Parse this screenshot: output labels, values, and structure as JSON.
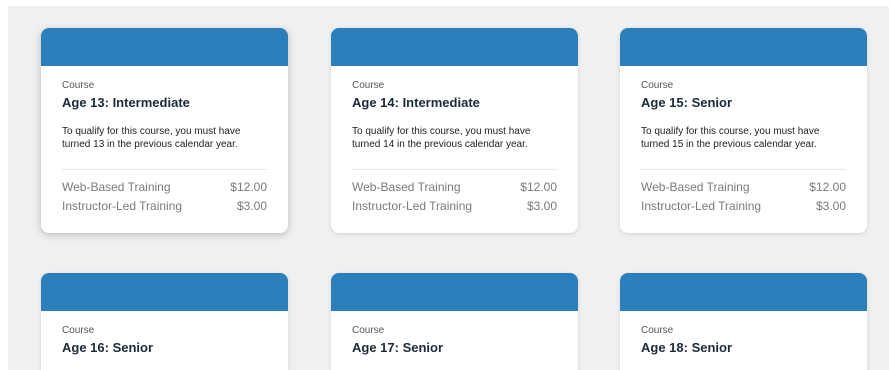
{
  "courses": [
    {
      "kind": "Course",
      "title": "Age 13: Intermediate",
      "description": "To qualify for this course, you must have turned 13 in the previous calendar year.",
      "prices": [
        {
          "label": "Web-Based Training",
          "price": "$12.00"
        },
        {
          "label": "Instructor-Led Training",
          "price": "$3.00"
        }
      ]
    },
    {
      "kind": "Course",
      "title": "Age 14: Intermediate",
      "description": "To qualify for this course, you must have turned 14 in the previous calendar year.",
      "prices": [
        {
          "label": "Web-Based Training",
          "price": "$12.00"
        },
        {
          "label": "Instructor-Led Training",
          "price": "$3.00"
        }
      ]
    },
    {
      "kind": "Course",
      "title": "Age 15: Senior",
      "description": "To qualify for this course, you must have turned 15 in the previous calendar year.",
      "prices": [
        {
          "label": "Web-Based Training",
          "price": "$12.00"
        },
        {
          "label": "Instructor-Led Training",
          "price": "$3.00"
        }
      ]
    },
    {
      "kind": "Course",
      "title": "Age 16: Senior"
    },
    {
      "kind": "Course",
      "title": "Age 17: Senior"
    },
    {
      "kind": "Course",
      "title": "Age 18: Senior"
    }
  ],
  "colors": {
    "header": "#2b7fbb",
    "background": "#f0f0f0"
  }
}
